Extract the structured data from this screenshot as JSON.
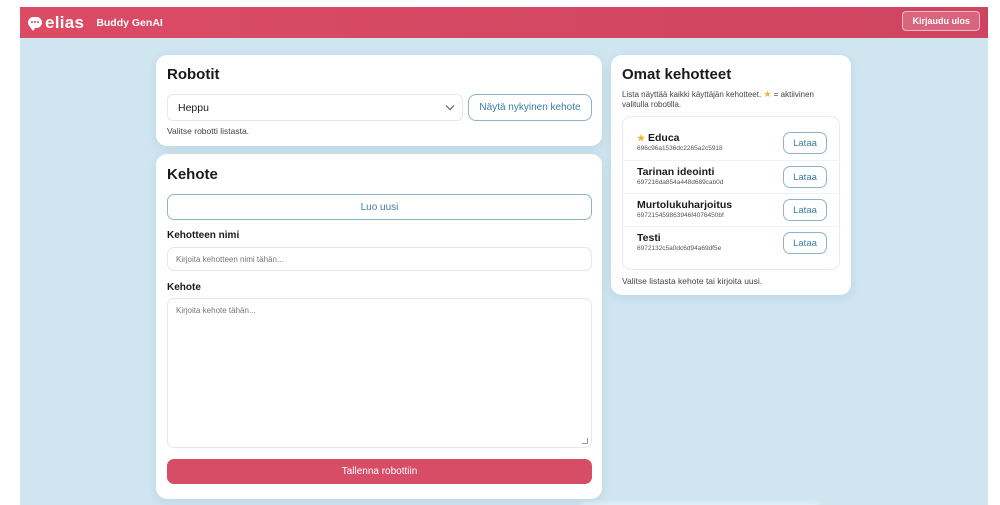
{
  "header": {
    "logo_text": "elias",
    "app_name": "Buddy GenAI",
    "logout_label": "Kirjaudu ulos"
  },
  "robots": {
    "title": "Robotit",
    "selected_robot": "Heppu",
    "show_prompt_label": "Näytä nykyinen kehote",
    "hint": "Valitse robotti listasta."
  },
  "prompt": {
    "title": "Kehote",
    "new_label": "Luo uusi",
    "name_label": "Kehotteen nimi",
    "name_placeholder": "Kirjoita kehotteen nimi tähän...",
    "text_label": "Kehote",
    "text_placeholder": "Kirjoita kehote tähän...",
    "save_label": "Tallenna robottiin"
  },
  "own_prompts": {
    "title": "Omat kehotteet",
    "description_before": "Lista näyttää kaikki käyttäjän kehotteet.",
    "description_after": "= aktiivinen valitulla robotilla.",
    "load_label": "Lataa",
    "items": [
      {
        "name": "Educa",
        "id": "696c96a1536dc2265a2c5918",
        "active": true
      },
      {
        "name": "Tarinan ideointi",
        "id": "697216da854a448d689cab0d",
        "active": false
      },
      {
        "name": "Murtolukuharjoitus",
        "id": "697215459863946f4076450bf",
        "active": false
      },
      {
        "name": "Testi",
        "id": "6972132c5a0dc6d94a69df5e",
        "active": false
      }
    ],
    "hint": "Valitse listasta kehote tai kirjoita uusi."
  },
  "colors": {
    "header": "#d8475f",
    "background": "#cfe6f1",
    "accent_text": "#3d7ea3",
    "primary_button": "#d84d66",
    "star": "#f2b530"
  },
  "icons": {
    "logo": "chat-bubble-icon",
    "active_marker": "star-icon",
    "select_arrow": "chevron-down-icon"
  }
}
